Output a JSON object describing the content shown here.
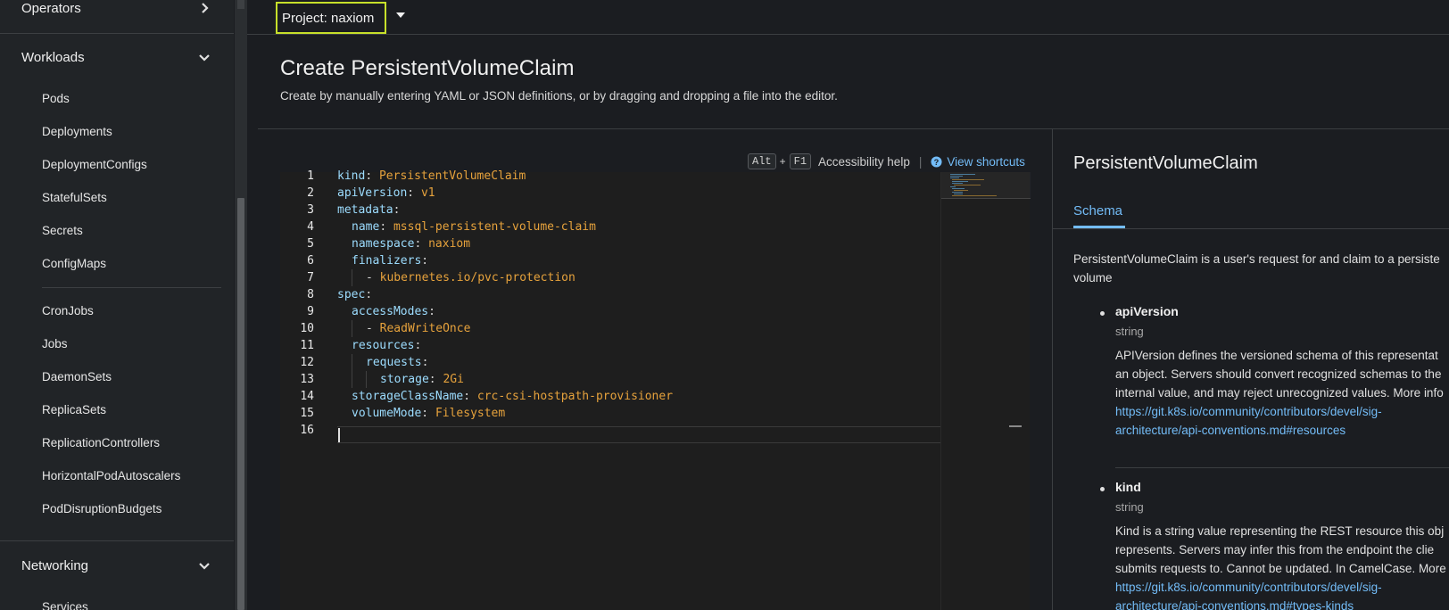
{
  "sidebar": {
    "sections": [
      {
        "label": "Operators",
        "chevron": "chevron-right-icon"
      },
      {
        "label": "Workloads",
        "chevron": "chevron-down-icon"
      },
      {
        "label": "Networking",
        "chevron": "chevron-down-icon"
      }
    ],
    "workload_items": [
      "Pods",
      "Deployments",
      "DeploymentConfigs",
      "StatefulSets",
      "Secrets",
      "ConfigMaps",
      "CronJobs",
      "Jobs",
      "DaemonSets",
      "ReplicaSets",
      "ReplicationControllers",
      "HorizontalPodAutoscalers",
      "PodDisruptionBudgets"
    ],
    "networking_items": [
      "Services"
    ]
  },
  "topbar": {
    "project_label": "Project: naxiom"
  },
  "header": {
    "title": "Create PersistentVolumeClaim",
    "description": "Create by manually entering YAML or JSON definitions, or by dragging and dropping a file into the editor."
  },
  "editor": {
    "shortcut_key1": "Alt",
    "shortcut_plus": "+",
    "shortcut_key2": "F1",
    "accessibility_help": "Accessibility help",
    "separator": "|",
    "view_shortcuts": "View shortcuts",
    "line_numbers": [
      "1",
      "2",
      "3",
      "4",
      "5",
      "6",
      "7",
      "8",
      "9",
      "10",
      "11",
      "12",
      "13",
      "14",
      "15",
      "16"
    ],
    "lines": [
      {
        "key": "kind",
        "sep": ": ",
        "value": "PersistentVolumeClaim"
      },
      {
        "key": "apiVersion",
        "sep": ": ",
        "value": "v1"
      },
      {
        "key": "metadata",
        "sep": ":",
        "value": ""
      },
      {
        "key": "name",
        "sep": ": ",
        "value": "mssql-persistent-volume-claim"
      },
      {
        "key": "namespace",
        "sep": ": ",
        "value": "naxiom"
      },
      {
        "key": "finalizers",
        "sep": ":",
        "value": ""
      },
      {
        "key": "- ",
        "sep": "",
        "value": "kubernetes.io/pvc-protection"
      },
      {
        "key": "spec",
        "sep": ":",
        "value": ""
      },
      {
        "key": "accessModes",
        "sep": ":",
        "value": ""
      },
      {
        "key": "- ",
        "sep": "",
        "value": "ReadWriteOnce"
      },
      {
        "key": "resources",
        "sep": ":",
        "value": ""
      },
      {
        "key": "requests",
        "sep": ":",
        "value": ""
      },
      {
        "key": "storage",
        "sep": ": ",
        "value": "2Gi"
      },
      {
        "key": "storageClassName",
        "sep": ": ",
        "value": "crc-csi-hostpath-provisioner"
      },
      {
        "key": "volumeMode",
        "sep": ": ",
        "value": "Filesystem"
      },
      {
        "key": "",
        "sep": "",
        "value": ""
      }
    ]
  },
  "panel": {
    "title": "PersistentVolumeClaim",
    "tab": "Schema",
    "intro_line1": "PersistentVolumeClaim is a user's request for and claim to a persiste",
    "intro_line2": "volume",
    "fields": [
      {
        "name": "apiVersion",
        "type": "string",
        "desc": [
          "APIVersion defines the versioned schema of this representat",
          "an object. Servers should convert recognized schemas to the",
          "internal value, and may reject unrecognized values. More info"
        ],
        "link": [
          "https://git.k8s.io/community/contributors/devel/sig-",
          "architecture/api-conventions.md#resources"
        ]
      },
      {
        "name": "kind",
        "type": "string",
        "desc": [
          "Kind is a string value representing the REST resource this obj",
          "represents. Servers may infer this from the endpoint the clie",
          "submits requests to. Cannot be updated. In CamelCase. More"
        ],
        "link": [
          "https://git.k8s.io/community/contributors/devel/sig-",
          "architecture/api-conventions.md#types-kinds"
        ]
      }
    ]
  },
  "colors": {
    "project_highlight": "#c7e02a",
    "link": "#73bcf7",
    "yaml_key": "#9cdcfe",
    "yaml_value": "#e6a23c"
  }
}
